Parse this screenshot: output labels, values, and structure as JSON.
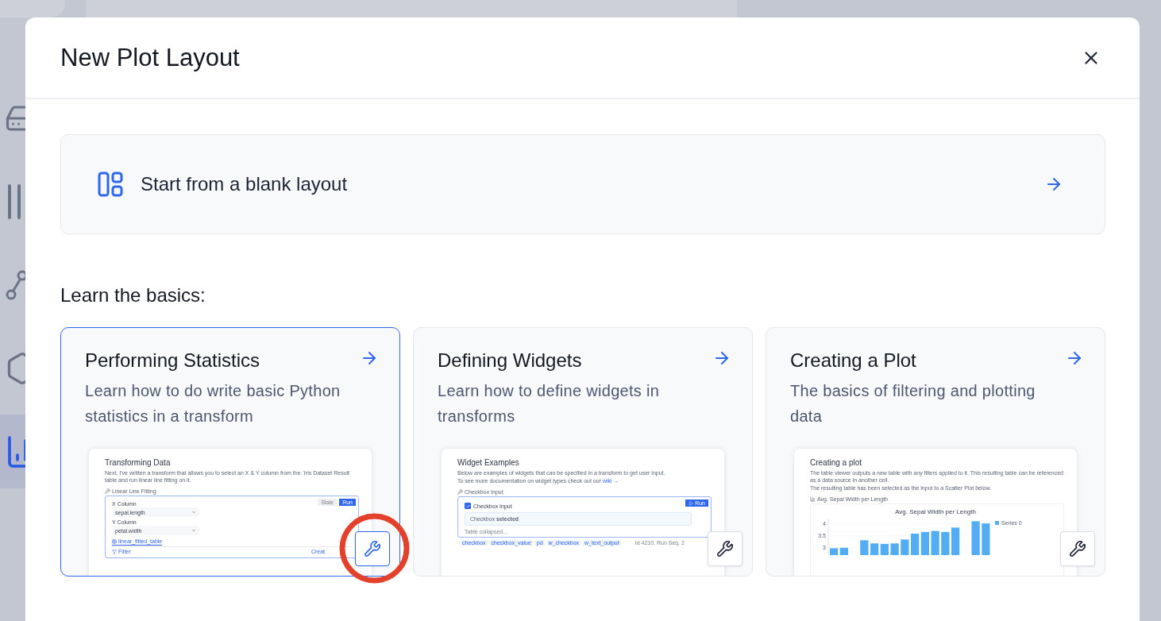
{
  "sidebar": {
    "items": [
      {
        "kind": "drive",
        "selected": false
      },
      {
        "kind": "bars",
        "selected": false
      },
      {
        "kind": "nodes",
        "selected": false
      },
      {
        "kind": "hexagon",
        "selected": false
      },
      {
        "kind": "chart",
        "selected": true
      }
    ]
  },
  "dialog": {
    "title": "New Plot Layout",
    "blank_option": {
      "label": "Start from a blank layout"
    },
    "section_title": "Learn the basics:",
    "cards": [
      {
        "title": "Performing Statistics",
        "description": "Learn how to do write basic Python statistics in a transform",
        "selected": true,
        "highlighted": true,
        "preview": {
          "kind": "transform",
          "title": "Transforming Data",
          "paragraphs": [
            "Next, I've written a transform that allows you to select an X & Y column from the `Iris Dataset Result` table and run linear line fitting on it."
          ],
          "cell_label": "Linear Line Fitting",
          "stale_button": "Stale",
          "run_button": "Run",
          "fields": [
            {
              "label": "X Column",
              "value": "sepal.length"
            },
            {
              "label": "Y Column",
              "value": "petal.width"
            }
          ],
          "tab": "linear_fitted_table",
          "filter": "Filter",
          "create": "Creat"
        }
      },
      {
        "title": "Defining Widgets",
        "description": "Learn how to define widgets in transforms",
        "selected": false,
        "highlighted": false,
        "preview": {
          "kind": "widget",
          "title": "Widget Examples",
          "paragraphs": [
            "Below are examples of widgets that can be specified in a transform to get user input."
          ],
          "link_line": "To see more documentation on widget types check out our",
          "link": "wiki →",
          "cell_label": "Checkbox Input",
          "run_button": "Run",
          "checkbox": {
            "label": "Checkbox Input",
            "checked": true
          },
          "output": "Checkbox **selected**",
          "collapsed": "Table collapsed...",
          "tags": [
            "checkbox",
            "checkbox_value",
            "pd",
            "w_checkbox",
            "w_text_output"
          ],
          "meta": "Id 4210, Run Seq. 2"
        }
      },
      {
        "title": "Creating a Plot",
        "description": "The basics of filtering and plotting data",
        "selected": false,
        "highlighted": false,
        "preview": {
          "kind": "plot",
          "title": "Creating a plot",
          "paragraphs": [
            "The table viewer outputs a new table with any filters applied to it. This resulting table can be referenced as a data source in another cell.",
            "The resulting table has been selected as the input to a Scatter Plot below."
          ],
          "cell_label": "Avg. Sepal Width per Length",
          "chart_data": {
            "type": "bar",
            "title": "Avg. Sepal Width per Length",
            "ylim": [
              2.7,
              4.2
            ],
            "yticks": [
              3,
              3.5,
              4
            ],
            "series": [
              {
                "name": "Series 0",
                "color": "#52adf5",
                "values": [
                  2.98,
                  3.0,
                  null,
                  3.31,
                  3.18,
                  3.16,
                  3.18,
                  3.34,
                  3.58,
                  3.65,
                  3.69,
                  3.65,
                  3.83,
                  null,
                  4.09,
                  4.0
                ]
              }
            ]
          }
        }
      }
    ]
  }
}
